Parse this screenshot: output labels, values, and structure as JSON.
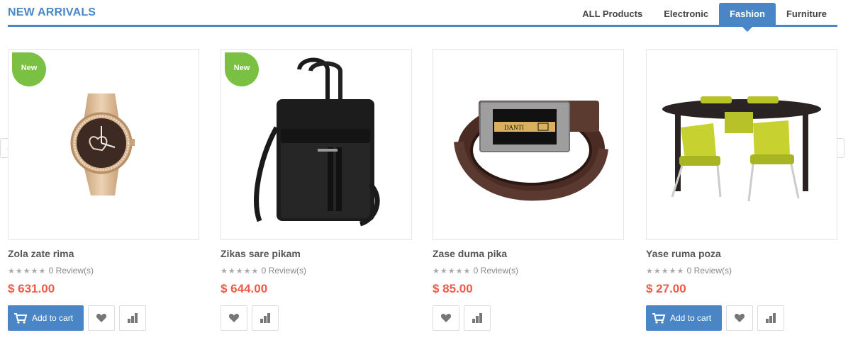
{
  "section": {
    "title": "NEW ARRIVALS",
    "tabs": [
      {
        "label": "ALL Products",
        "active": false
      },
      {
        "label": "Electronic",
        "active": false
      },
      {
        "label": "Fashion",
        "active": true
      },
      {
        "label": "Furniture",
        "active": false
      }
    ]
  },
  "nav": {
    "prev_icon": "chevron-left-icon",
    "next_icon": "chevron-right-icon"
  },
  "colors": {
    "accent": "#4a86c5",
    "price": "#ef5b4b",
    "badge": "#7ac143"
  },
  "products": [
    {
      "name": "Zola zate rima",
      "reviews": "0 Review(s)",
      "price": "$ 631.00",
      "badge": "New",
      "add_to_cart": "Add to cart",
      "image": "wristwatch",
      "has_cart_button": true
    },
    {
      "name": "Zikas sare pikam",
      "reviews": "0 Review(s)",
      "price": "$ 644.00",
      "badge": "New",
      "add_to_cart": "",
      "image": "black-leather-bag",
      "has_cart_button": false
    },
    {
      "name": "Zase duma pika",
      "reviews": "0 Review(s)",
      "price": "$ 85.00",
      "badge": "",
      "add_to_cart": "",
      "image": "brown-leather-belt",
      "has_cart_button": false
    },
    {
      "name": "Yase ruma poza",
      "reviews": "0 Review(s)",
      "price": "$ 27.00",
      "badge": "",
      "add_to_cart": "Add to cart",
      "image": "dining-table-set",
      "has_cart_button": true
    }
  ]
}
